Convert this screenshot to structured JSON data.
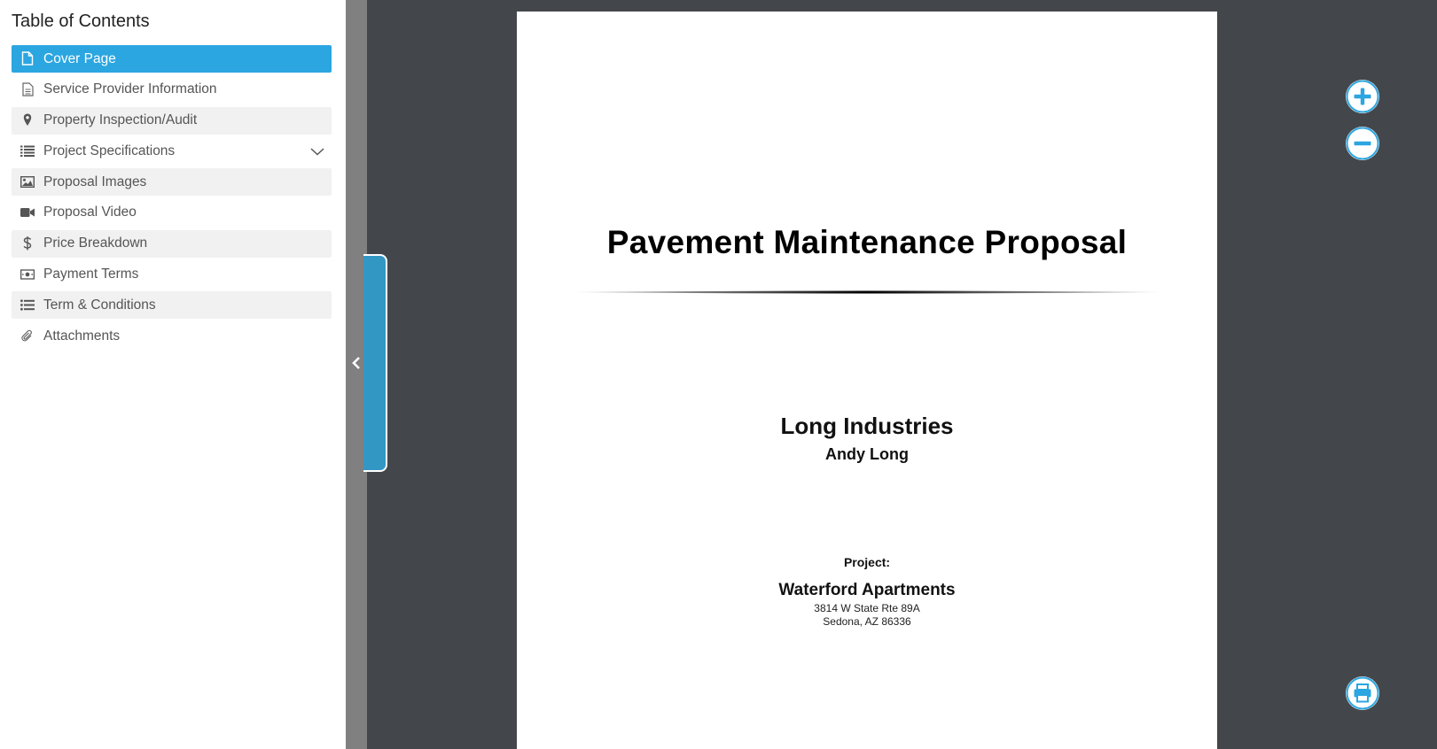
{
  "sidebar": {
    "title": "Table of Contents",
    "items": [
      {
        "label": "Cover Page",
        "icon": "document-icon"
      },
      {
        "label": "Service Provider Information",
        "icon": "file-text-icon"
      },
      {
        "label": "Property Inspection/Audit",
        "icon": "map-pin-icon"
      },
      {
        "label": "Project Specifications",
        "icon": "list-icon"
      },
      {
        "label": "Proposal Images",
        "icon": "image-icon"
      },
      {
        "label": "Proposal Video",
        "icon": "video-icon"
      },
      {
        "label": "Price Breakdown",
        "icon": "dollar-icon"
      },
      {
        "label": "Payment Terms",
        "icon": "money-bill-icon"
      },
      {
        "label": "Term & Conditions",
        "icon": "list-ul-icon"
      },
      {
        "label": "Attachments",
        "icon": "paperclip-icon"
      }
    ]
  },
  "document": {
    "title": "Pavement Maintenance Proposal",
    "company": "Long Industries",
    "contact": "Andy Long",
    "project_label": "Project:",
    "project_name": "Waterford Apartments",
    "address_line1": "3814 W State Rte 89A",
    "address_line2": "Sedona, AZ 86336"
  },
  "colors": {
    "accent": "#2ba6e1",
    "collapse_tab": "#3397c4",
    "viewer_bg": "#43474b",
    "divider": "#808080"
  },
  "controls": {
    "zoom_in": "plus-circle-icon",
    "zoom_out": "minus-circle-icon",
    "print": "print-icon"
  }
}
